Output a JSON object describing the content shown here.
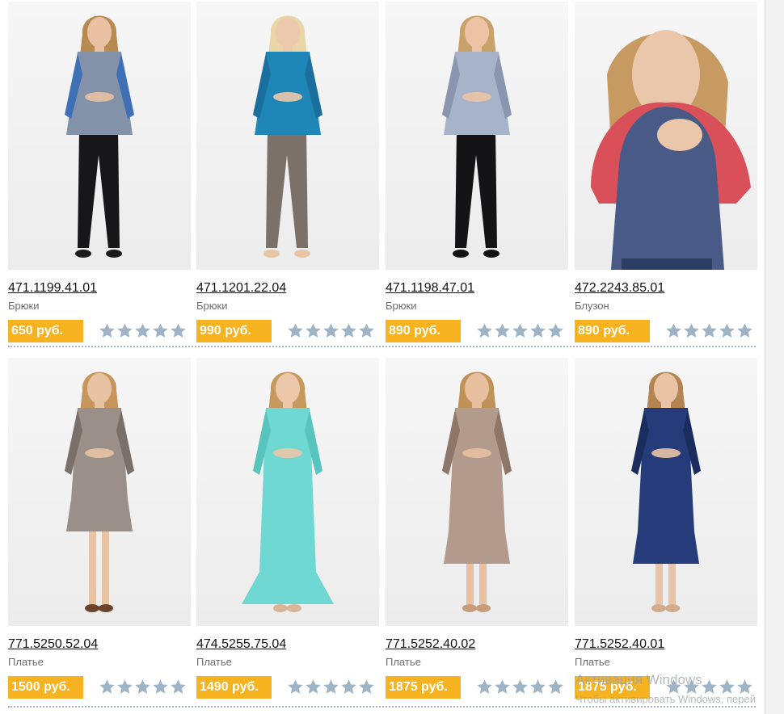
{
  "products": [
    {
      "sku": "471.1199.41.01",
      "category": "Брюки",
      "price": "650 руб.",
      "rating": 0,
      "colors": {
        "skin": "#e9c2a4",
        "hair": "#b78a4f",
        "top": "#8391a9",
        "topAccent": "#3f6fb5",
        "bottom": "#17171a",
        "shoe": "#1a1a1a"
      },
      "style": "pants"
    },
    {
      "sku": "471.1201.22.04",
      "category": "Брюки",
      "price": "990 руб.",
      "rating": 0,
      "colors": {
        "skin": "#ecc9ad",
        "hair": "#e9d7a8",
        "top": "#1f86b8",
        "topAccent": "#1a6f9c",
        "bottom": "#7b7168",
        "shoe": "#e8c4a7"
      },
      "style": "pants"
    },
    {
      "sku": "471.1198.47.01",
      "category": "Брюки",
      "price": "890 руб.",
      "rating": 0,
      "colors": {
        "skin": "#ecc4a5",
        "hair": "#c9a26a",
        "top": "#a7b3c8",
        "topAccent": "#8a96ad",
        "bottom": "#141416",
        "shoe": "#121212"
      },
      "style": "pants"
    },
    {
      "sku": "472.2243.85.01",
      "category": "Блузон",
      "price": "890 руб.",
      "rating": 0,
      "colors": {
        "skin": "#eac6ab",
        "hair": "#c79a62",
        "top": "#4a5a86",
        "topAccent": "#d9505a",
        "bottom": "#2c3d62",
        "shoe": "#2c3d62"
      },
      "style": "closeup"
    },
    {
      "sku": "771.5250.52.04",
      "category": "Платье",
      "price": "1500 руб.",
      "rating": 0,
      "colors": {
        "skin": "#e8c3a3",
        "hair": "#c6965d",
        "top": "#9a8f89",
        "topAccent": "#7a6f69",
        "bottom": "#9a8f89",
        "shoe": "#6d4328"
      },
      "style": "dress-short"
    },
    {
      "sku": "474.5255.75.04",
      "category": "Платье",
      "price": "1490 руб.",
      "rating": 0,
      "colors": {
        "skin": "#ecc7a9",
        "hair": "#c7985d",
        "top": "#6fd8d2",
        "topAccent": "#58c4be",
        "bottom": "#6fd8d2",
        "shoe": "#d8b596"
      },
      "style": "dress-long"
    },
    {
      "sku": "771.5252.40.02",
      "category": "Платье",
      "price": "1875 руб.",
      "rating": 0,
      "colors": {
        "skin": "#e7c0a0",
        "hair": "#c09257",
        "top": "#b29a8c",
        "topAccent": "#8e7669",
        "bottom": "#b29a8c",
        "shoe": "#c79c7c"
      },
      "style": "dress"
    },
    {
      "sku": "771.5252.40.01",
      "category": "Платье",
      "price": "1875 руб.",
      "rating": 0,
      "colors": {
        "skin": "#e9c3a5",
        "hair": "#b48550",
        "top": "#263c7a",
        "topAccent": "#1b2d5f",
        "bottom": "#263c7a",
        "shoe": "#d2ab8b"
      },
      "style": "dress"
    }
  ],
  "star_color": "#9fb3c6",
  "price_color": "#f7b21f",
  "watermark": {
    "line1": "Активация Windows",
    "line2": "Чтобы активировать Windows, перей"
  }
}
